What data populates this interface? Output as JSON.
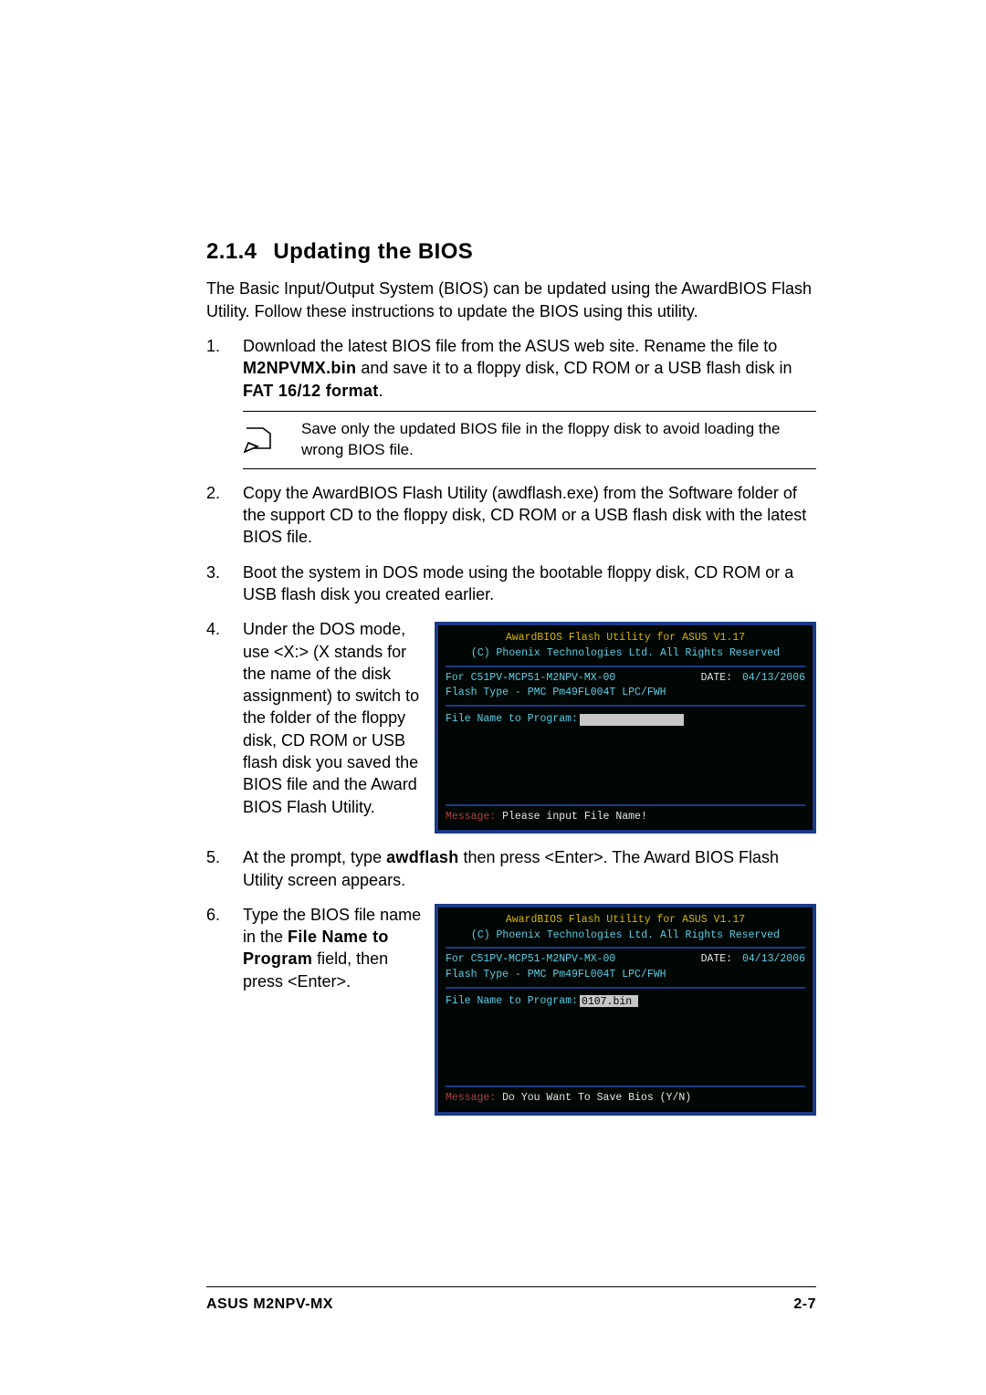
{
  "section": {
    "number": "2.1.4",
    "title": "Updating the BIOS"
  },
  "intro": "The Basic Input/Output System (BIOS) can be updated using the AwardBIOS Flash Utility. Follow these instructions to update the BIOS using this utility.",
  "steps": {
    "s1": {
      "a": "Download the latest BIOS file from the ASUS web site. Rename the file to ",
      "b": "M2NPVMX.bin",
      "c": " and save it to a floppy disk, CD ROM or a USB flash disk in ",
      "d": "FAT 16/12 format",
      "e": "."
    },
    "note": "Save only the updated BIOS file in the floppy disk to avoid loading the wrong BIOS file.",
    "s2": "Copy the AwardBIOS Flash Utility (awdflash.exe) from the Software folder of the support CD to the floppy disk, CD ROM or a USB flash disk with the latest BIOS file.",
    "s3": "Boot the system in DOS mode using the bootable floppy disk, CD ROM or a USB flash disk you created earlier.",
    "s4": "Under the DOS mode, use <X:> (X stands for the name of the disk assignment) to switch to the folder of the floppy disk, CD ROM or USB flash disk you saved the BIOS file and the Award BIOS Flash Utility.",
    "s5": {
      "a": "At the prompt, type ",
      "b": "awdflash",
      "c": " then press <Enter>. The Award BIOS Flash Utility screen appears."
    },
    "s6": {
      "a": "Type the BIOS file name in the ",
      "b": "File Name to Program",
      "c": " field, then press <Enter>."
    }
  },
  "bios": {
    "title": "AwardBIOS Flash Utility for ASUS V1.17",
    "copyright": "(C) Phoenix Technologies Ltd. All Rights Reserved",
    "for": "For C51PV-MCP51-M2NPV-MX-00",
    "date_label": "DATE:",
    "date": "04/13/2006",
    "flash_type": "Flash Type - PMC Pm49FL004T LPC/FWH",
    "field_label": "File Name to Program:",
    "file_value": "0107.bin",
    "msg_label": "Message:",
    "msg1": "Please input File Name!",
    "msg2": "Do You Want To Save Bios (Y/N)"
  },
  "footer": {
    "left": "ASUS M2NPV-MX",
    "right": "2-7"
  }
}
